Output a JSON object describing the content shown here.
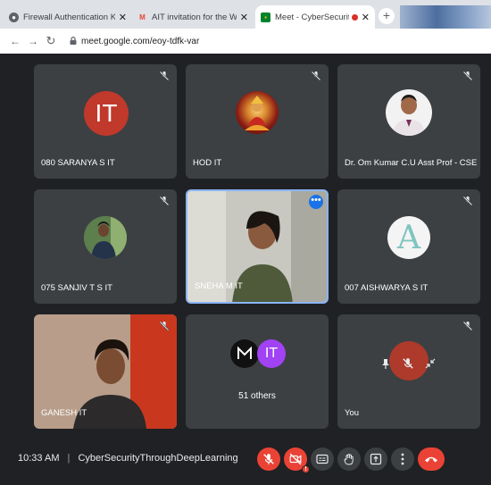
{
  "browser": {
    "tabs": [
      {
        "title": "Firewall Authentication Keepalive",
        "icon": "globe-icon",
        "active": false
      },
      {
        "title": "AIT invitation for the Workshop o",
        "icon": "gmail-icon",
        "active": false
      },
      {
        "title": "Meet - CyberSecurityThroug",
        "icon": "meet-icon",
        "active": true
      }
    ],
    "url": "meet.google.com/eoy-tdfk-var"
  },
  "meeting": {
    "time": "10:33 AM",
    "separator": "|",
    "name": "CyberSecurityThroughDeepLearning"
  },
  "participants": [
    {
      "name": "080 SARANYA S IT",
      "avatar_text": "IT",
      "avatar_color": "#c0392b",
      "muted": true
    },
    {
      "name": "HOD IT",
      "avatar": "goddess-image",
      "muted": true
    },
    {
      "name": "Dr. Om Kumar C.U Asst Prof - CSE De...",
      "avatar": "person-photo",
      "muted": true
    },
    {
      "name": "075 SANJIV T S IT",
      "avatar": "person-photo",
      "muted": true
    },
    {
      "name": "SNEHA M IT",
      "video": true,
      "speaking": true
    },
    {
      "name": "007 AISHWARYA S IT",
      "avatar_text": "A",
      "muted": true
    },
    {
      "name": "GANESH IT",
      "video": true,
      "muted": true
    },
    {
      "name": "51 others",
      "avatar_text": "IT",
      "avatar_color": "#a142f4"
    },
    {
      "name": "You",
      "muted": true,
      "camera_off": true
    }
  ],
  "colors": {
    "meet_bg": "#202124",
    "tile_bg": "#3c4043",
    "danger": "#ea4335",
    "speaking_border": "#8ab4f8"
  }
}
